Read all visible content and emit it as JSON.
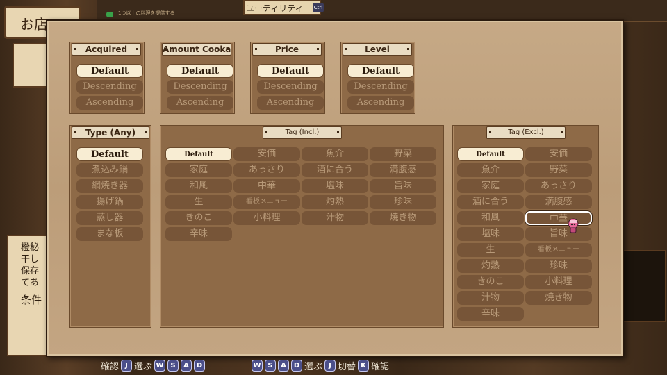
{
  "background": {
    "shop_label": "お店",
    "utility_title": "ユーティリティ",
    "ctrl_key": "Ctrl",
    "hint": "1つ以上の料理を提供する",
    "lower_text": [
      "橙秘",
      "干し",
      "保存",
      "てあ",
      "",
      "条件"
    ]
  },
  "sort_boxes": [
    {
      "header": "Acquired",
      "options": [
        "Default",
        "Descending",
        "Ascending"
      ],
      "selected": 0
    },
    {
      "header": "Amount Cookable",
      "options": [
        "Default",
        "Descending",
        "Ascending"
      ],
      "selected": 0
    },
    {
      "header": "Price",
      "options": [
        "Default",
        "Descending",
        "Ascending"
      ],
      "selected": 0
    },
    {
      "header": "Level",
      "options": [
        "Default",
        "Descending",
        "Ascending"
      ],
      "selected": 0
    }
  ],
  "type_box": {
    "header": "Type (Any)",
    "options": [
      "Default",
      "煮込み鍋",
      "網焼き器",
      "揚げ鍋",
      "蒸し器",
      "まな板"
    ],
    "selected": 0
  },
  "tag_incl": {
    "header": "Tag (Incl.)",
    "options": [
      "Default",
      "安価",
      "魚介",
      "野菜",
      "家庭",
      "あっさり",
      "酒に合う",
      "満腹感",
      "和風",
      "中華",
      "塩味",
      "旨味",
      "生",
      "看板メニュー",
      "灼熱",
      "珍味",
      "きのこ",
      "小料理",
      "汁物",
      "焼き物",
      "辛味"
    ],
    "selected": 0
  },
  "tag_excl": {
    "header": "Tag (Excl.)",
    "options": [
      "Default",
      "安価",
      "魚介",
      "野菜",
      "家庭",
      "あっさり",
      "酒に合う",
      "満腹感",
      "和風",
      "中華",
      "塩味",
      "旨味",
      "生",
      "看板メニュー",
      "灼熱",
      "珍味",
      "きのこ",
      "小料理",
      "汁物",
      "焼き物",
      "辛味"
    ],
    "selected": 0,
    "cursor_index": 9
  },
  "footer_left": {
    "confirm": "確認",
    "confirm_key": "J",
    "select": "選ぶ",
    "keys": [
      "W",
      "S",
      "A",
      "D"
    ]
  },
  "footer_right": {
    "keys": [
      "W",
      "S",
      "A",
      "D"
    ],
    "select": "選ぶ",
    "toggle_key": "J",
    "toggle": "切替",
    "confirm_key": "K",
    "confirm": "確認"
  }
}
